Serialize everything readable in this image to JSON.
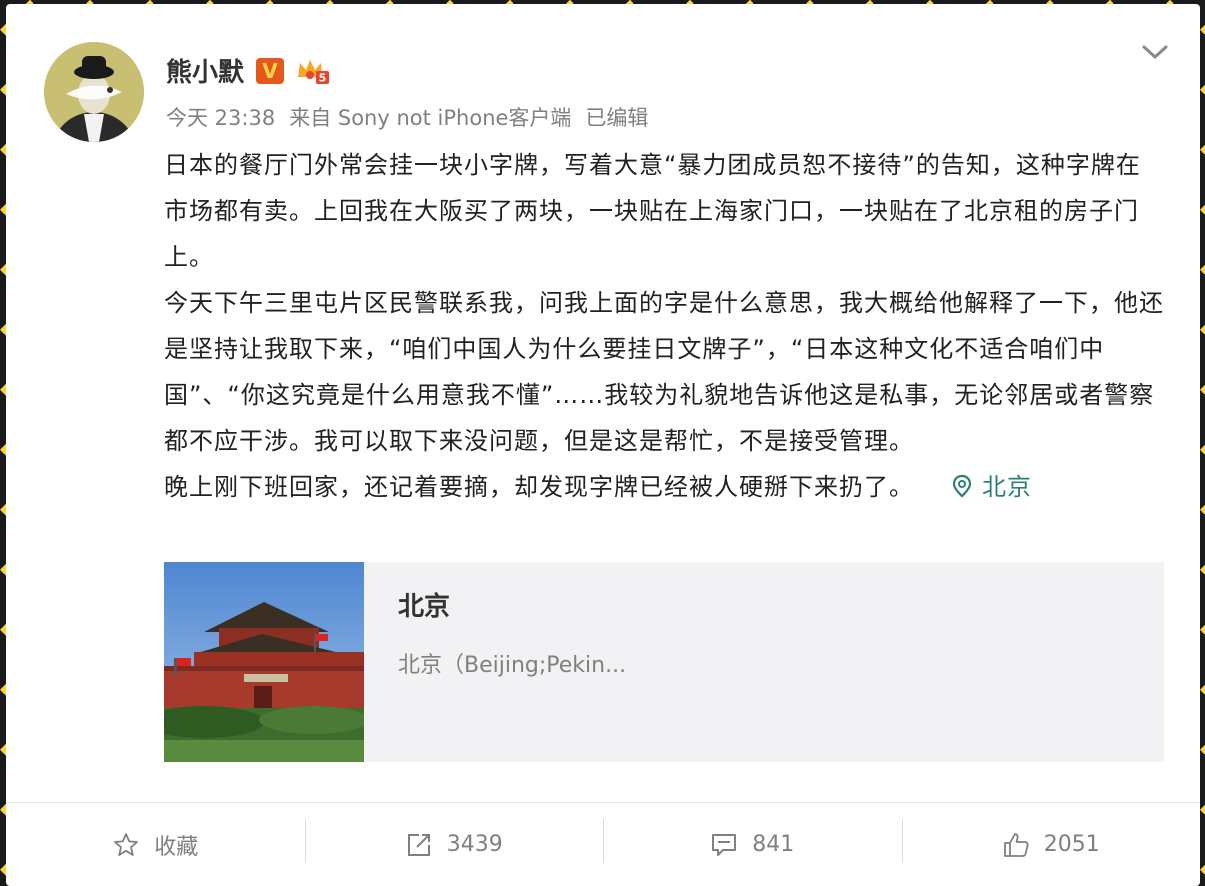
{
  "author": {
    "name": "熊小默",
    "verified_badge": "V",
    "level_badge": "5"
  },
  "meta": {
    "time": "今天 23:38",
    "source": "来自 Sony not iPhone客户端",
    "edited": "已编辑"
  },
  "post": {
    "paragraphs": [
      "日本的餐厅门外常会挂一块小字牌，写着大意“暴力团成员恕不接待”的告知，这种字牌在市场都有卖。上回我在大阪买了两块，一块贴在上海家门口，一块贴在了北京租的房子门上。",
      "今天下午三里屯片区民警联系我，问我上面的字是什么意思，我大概给他解释了一下，他还是坚持让我取下来，“咱们中国人为什么要挂日文牌子”，“日本这种文化不适合咱们中国”、“你这究竟是什么用意我不懂”……我较为礼貌地告诉他这是私事，无论邻居或者警察都不应干涉。我可以取下来没问题，但是这是帮忙，不是接受管理。",
      "晚上刚下班回家，还记着要摘，却发现字牌已经被人硬掰下来扔了。"
    ],
    "location": "北京"
  },
  "place_card": {
    "title": "北京",
    "description": "北京（Beijing;Pekin..."
  },
  "actions": {
    "favorite": "收藏",
    "repost_count": "3439",
    "comment_count": "841",
    "like_count": "2051"
  },
  "colors": {
    "location": "#2f7f73",
    "verified": "#e6571c",
    "meta_text": "#808080"
  }
}
